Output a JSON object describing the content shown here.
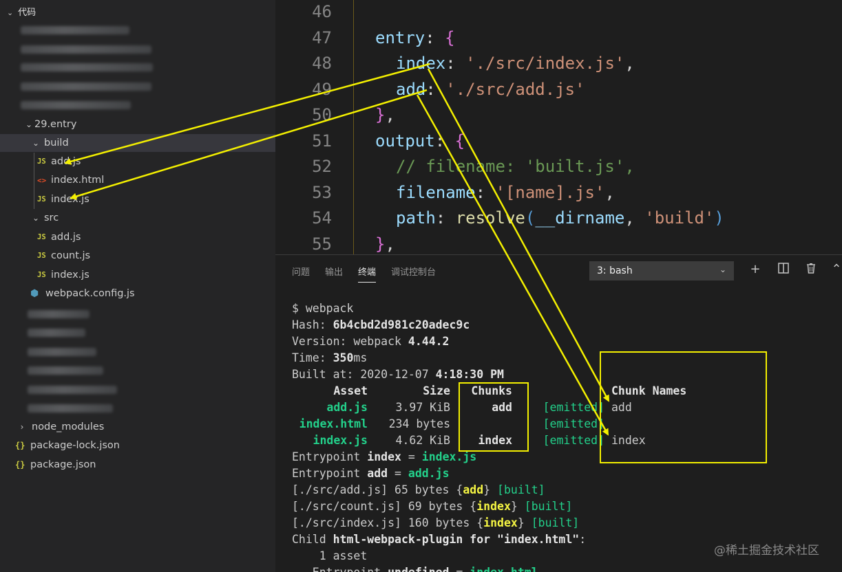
{
  "sidebar": {
    "header": "代码",
    "folder_29": "29.entry",
    "folder_build": "build",
    "build_files": [
      "add.js",
      "index.html",
      "index.js"
    ],
    "folder_src": "src",
    "src_files": [
      "add.js",
      "count.js",
      "index.js"
    ],
    "webpack_config": "webpack.config.js",
    "node_modules": "node_modules",
    "package_lock": "package-lock.json",
    "package_json": "package.json",
    "js_icon_text": "JS",
    "html_icon_text": "<>",
    "json_icon_text": "{}"
  },
  "editor": {
    "line_numbers": [
      "46",
      "47",
      "48",
      "49",
      "50",
      "51",
      "52",
      "53",
      "54",
      "55"
    ],
    "l47": {
      "key": "entry",
      "colon": ":",
      "brace": "{"
    },
    "l48": {
      "key": "index",
      "colon": ":",
      "str": "'./src/index.js'",
      "comma": ","
    },
    "l49": {
      "key": "add",
      "colon": ":",
      "str": "'./src/add.js'"
    },
    "l50": {
      "brace": "}",
      "comma": ","
    },
    "l51": {
      "key": "output",
      "colon": ":",
      "brace": "{"
    },
    "l52": {
      "comment": "// filename: 'built.js',"
    },
    "l53": {
      "key": "filename",
      "colon": ":",
      "str": "'[name].js'",
      "comma": ","
    },
    "l54": {
      "key": "path",
      "colon": ":",
      "fn": "resolve",
      "open": "(",
      "arg": "__dirname",
      "sep": ",",
      "str": "'build'",
      "close": ")"
    },
    "l55": {
      "brace": "}",
      "comma": ","
    }
  },
  "panel": {
    "tabs": [
      "问题",
      "输出",
      "终端",
      "调试控制台"
    ],
    "active_tab": "终端",
    "terminal_select": "3: bash",
    "buttons": [
      "+",
      "split",
      "trash",
      "chevron-up"
    ]
  },
  "terminal": {
    "prompt": "$ webpack",
    "hash_label": "Hash: ",
    "hash": "6b4cbd2d981c20adec9c",
    "version_label": "Version: webpack ",
    "version": "4.44.2",
    "time_label": "Time: ",
    "time_value": "350",
    "time_unit": "ms",
    "built_label": "Built at: 2020-12-07 ",
    "built_time": "4:18:30 PM",
    "table_header": {
      "asset": "Asset",
      "size": "Size",
      "chunks": "Chunks",
      "chunk_names": "Chunk Names"
    },
    "rows": [
      {
        "asset": "add.js",
        "size": "3.97 KiB",
        "chunks": "add",
        "status": "[emitted]",
        "chunk_name": "add"
      },
      {
        "asset": "index.html",
        "size": "234 bytes",
        "chunks": "",
        "status": "[emitted]",
        "chunk_name": ""
      },
      {
        "asset": "index.js",
        "size": "4.62 KiB",
        "chunks": "index",
        "status": "[emitted]",
        "chunk_name": "index"
      }
    ],
    "entry1": {
      "prefix": "Entrypoint ",
      "name": "index",
      "eq": " = ",
      "file": "index.js"
    },
    "entry2": {
      "prefix": "Entrypoint ",
      "name": "add",
      "eq": " = ",
      "file": "add.js"
    },
    "mod1": {
      "path": "[./src/add.js] 65 bytes {",
      "chunk": "add",
      "close": "} ",
      "built": "[built]"
    },
    "mod2": {
      "path": "[./src/count.js] 69 bytes {",
      "chunk": "index",
      "close": "} ",
      "built": "[built]"
    },
    "mod3": {
      "path": "[./src/index.js] 160 bytes {",
      "chunk": "index",
      "close": "} ",
      "built": "[built]"
    },
    "child": {
      "prefix": "Child ",
      "name": "html-webpack-plugin",
      "mid": " for ",
      "target": "\"index.html\"",
      "colon": ":"
    },
    "asset_count": "    1 asset",
    "last_line": {
      "prefix": "   Entrypoint ",
      "name": "undefined",
      "eq": " = ",
      "file": "index.html"
    }
  },
  "watermark": "@稀土掘金技术社区",
  "colors": {
    "annotation": "#f4f000",
    "sidebar_bg": "#252526",
    "editor_bg": "#1e1e1e",
    "js_icon": "#cbcb41"
  }
}
